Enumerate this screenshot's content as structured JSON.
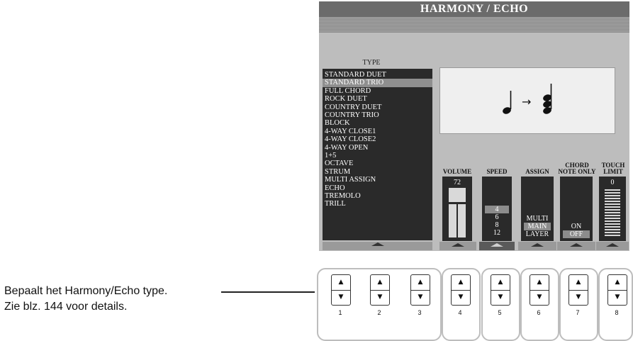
{
  "screen": {
    "title": "HARMONY / ECHO",
    "type_heading": "TYPE",
    "type_items": [
      "STANDARD DUET",
      "STANDARD TRIO",
      "FULL CHORD",
      "ROCK DUET",
      "COUNTRY DUET",
      "COUNTRY TRIO",
      "BLOCK",
      "4-WAY CLOSE1",
      "4-WAY CLOSE2",
      "4-WAY OPEN",
      "1+5",
      "OCTAVE",
      "STRUM",
      "MULTI ASSIGN",
      "ECHO",
      "TREMOLO",
      "TRILL"
    ],
    "selected_type": "STANDARD TRIO",
    "volume": {
      "label": "VOLUME",
      "value": "72"
    },
    "speed": {
      "label": "SPEED",
      "values": [
        "4",
        "6",
        "8",
        "12"
      ],
      "selected": "4"
    },
    "assign": {
      "label": "ASSIGN",
      "values": [
        "MULTI",
        "MAIN",
        "LAYER"
      ],
      "selected": "MAIN"
    },
    "chord_note_only": {
      "label_line1": "CHORD",
      "label_line2": "NOTE ONLY",
      "values": [
        "ON",
        "OFF"
      ],
      "selected": "OFF"
    },
    "touch_limit": {
      "label_line1": "TOUCH",
      "label_line2": "LIMIT",
      "value": "0"
    },
    "notation_arrow": "→"
  },
  "buttons": {
    "up_glyph": "▲",
    "down_glyph": "▼",
    "numbers": [
      "1",
      "2",
      "3",
      "4",
      "5",
      "6",
      "7",
      "8"
    ]
  },
  "caption": {
    "line1": "Bepaalt het Harmony/Echo type.",
    "line2": "Zie blz. 144 voor details."
  },
  "colors": {
    "screen_bg": "#bdbdbd",
    "title_bg": "#6b6b6b",
    "list_bg": "#2a2a2a",
    "highlight": "#8c8c8c"
  }
}
